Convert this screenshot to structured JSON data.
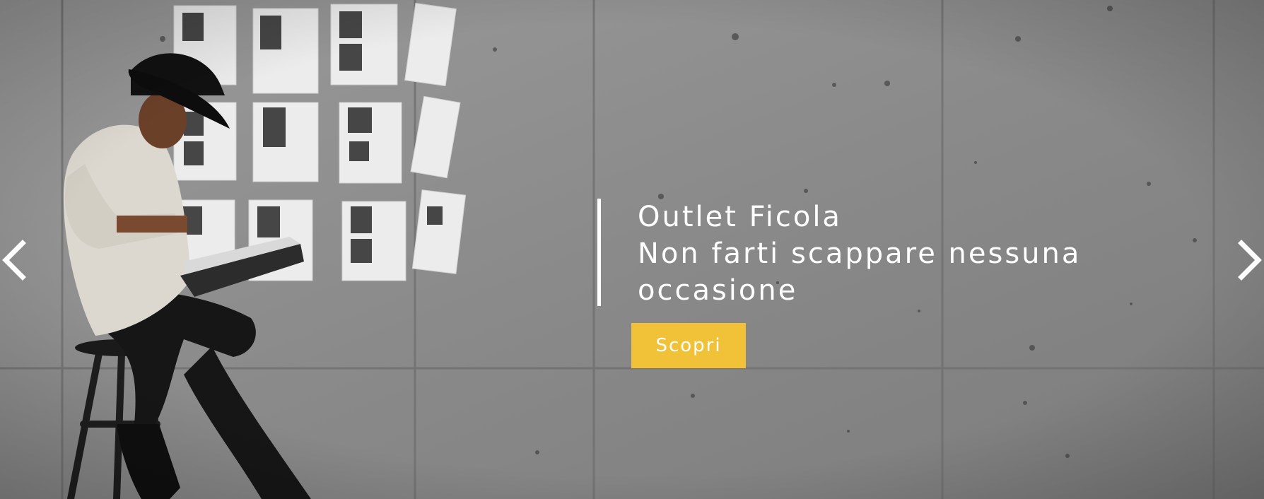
{
  "hero": {
    "caption_lines": [
      "Outlet Ficola",
      "Non farti scappare nessuna",
      "occasione"
    ],
    "cta_label": "Scopri",
    "prev_icon": "chevron-left-icon",
    "next_icon": "chevron-right-icon"
  },
  "colors": {
    "accent": "#f1c238",
    "text": "#ffffff",
    "wall": "#8d8d8d"
  }
}
